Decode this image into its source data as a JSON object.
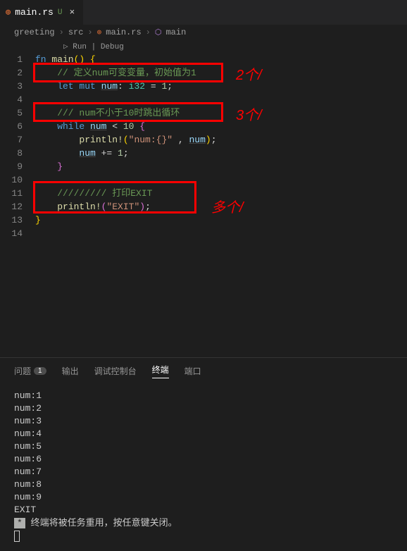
{
  "tab": {
    "name": "main.rs",
    "modified": "U"
  },
  "breadcrumb": {
    "p0": "greeting",
    "p1": "src",
    "p2": "main.rs",
    "p3": "main"
  },
  "codelens": "▷ Run | Debug",
  "lines": [
    "1",
    "2",
    "3",
    "4",
    "5",
    "6",
    "7",
    "8",
    "9",
    "10",
    "11",
    "12",
    "13",
    "14"
  ],
  "code": {
    "l1_fn": "fn ",
    "l1_main": "main",
    "l1_par": "() ",
    "l1_brace": "{",
    "l2": "    // 定义num可变变量，初始值为1",
    "l3_let": "    let ",
    "l3_mut": "mut ",
    "l3_num": "num",
    "l3_colon": ": ",
    "l3_type": "i32",
    "l3_eq": " = ",
    "l3_val": "1",
    "l3_semi": ";",
    "l5": "    /// num不小于10时跳出循环",
    "l6_while": "    while ",
    "l6_num": "num",
    "l6_lt": " < ",
    "l6_ten": "10 ",
    "l6_brace": "{",
    "l7_pad": "        ",
    "l7_mac": "println!",
    "l7_open": "(",
    "l7_str": "\"num:{}\"",
    "l7_comma": " , ",
    "l7_num": "num",
    "l7_close": ")",
    "l7_semi": ";",
    "l8_pad": "        ",
    "l8_num": "num",
    "l8_op": " += ",
    "l8_val": "1",
    "l8_semi": ";",
    "l9_pad": "    ",
    "l9_brace": "}",
    "l11": "    ///////// 打印EXIT",
    "l12_pad": "    ",
    "l12_mac": "println!",
    "l12_open": "(",
    "l12_str": "\"EXIT\"",
    "l12_close": ")",
    "l12_semi": ";",
    "l13": "}"
  },
  "annotations": {
    "a1": "2个/",
    "a2": "3个/",
    "a3": "多个/"
  },
  "panel": {
    "tabs": {
      "problems": "问题",
      "problems_count": "1",
      "output": "输出",
      "debug": "调试控制台",
      "terminal": "终端",
      "ports": "端口"
    },
    "out": [
      "num:1",
      "num:2",
      "num:3",
      "num:4",
      "num:5",
      "num:6",
      "num:7",
      "num:8",
      "num:9",
      "EXIT"
    ],
    "reuse_icon": "*",
    "reuse_msg": "终端将被任务重用，按任意键关闭。"
  }
}
